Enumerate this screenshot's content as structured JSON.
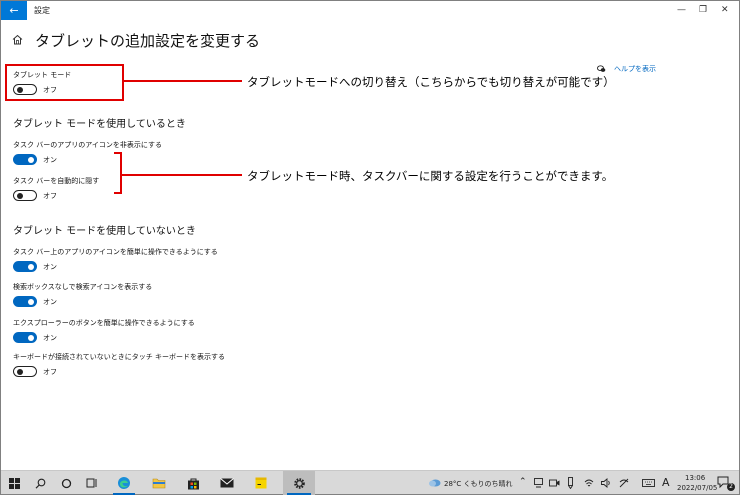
{
  "window": {
    "app_title": "設定",
    "back_glyph": "←",
    "minimize_glyph": "—",
    "restore_glyph": "❐",
    "close_glyph": "✕"
  },
  "header": {
    "title": "タブレットの追加設定を変更する"
  },
  "help": {
    "link_text": "ヘルプを表示"
  },
  "tablet_mode": {
    "label": "タブレット モード",
    "state": "オフ",
    "is_on": false
  },
  "section_using": {
    "title": "タブレット モードを使用しているとき",
    "settings": [
      {
        "label": "タスク バーのアプリのアイコンを非表示にする",
        "state": "オン",
        "is_on": true
      },
      {
        "label": "タスク バーを自動的に隠す",
        "state": "オフ",
        "is_on": false
      }
    ]
  },
  "section_not_using": {
    "title": "タブレット モードを使用していないとき",
    "settings": [
      {
        "label": "タスク バー上のアプリのアイコンを簡単に操作できるようにする",
        "state": "オン",
        "is_on": true
      },
      {
        "label": "検索ボックスなしで検索アイコンを表示する",
        "state": "オン",
        "is_on": true
      },
      {
        "label": "エクスプローラーのボタンを簡単に操作できるようにする",
        "state": "オン",
        "is_on": true
      },
      {
        "label": "キーボードが接続されていないときにタッチ キーボードを表示する",
        "state": "オフ",
        "is_on": false
      }
    ]
  },
  "annotations": {
    "tablet_mode": "タブレットモードへの切り替え（こちらからでも切り替えが可能です）",
    "taskbar": "タブレットモード時、タスクバーに関する設定を行うことができます。"
  },
  "taskbar": {
    "weather": "28°C くもりのち晴れ",
    "ime": "A",
    "time": "13:06",
    "date": "2022/07/05",
    "notification_count": "2"
  },
  "colors": {
    "accent": "#0067c0",
    "annotation_red": "#e00000",
    "titlebar_blue": "#0078d7",
    "taskbar_bg": "#d9d9d9"
  }
}
